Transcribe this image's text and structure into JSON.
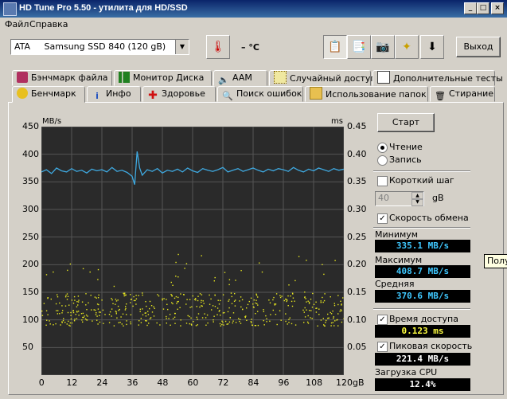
{
  "window": {
    "title": "HD Tune Pro 5.50 - утилита для HD/SSD"
  },
  "menu": [
    "Файл",
    "Справка"
  ],
  "toolbar": {
    "drive": "ATA     Samsung SSD 840 (120 gB)",
    "temperature": "– °C",
    "exit_label": "Выход"
  },
  "tabs_top": [
    "Бэнчмарк файла",
    "Монитор Диска",
    "AAM",
    "Случайный доступ",
    "Дополнительные  тесты"
  ],
  "tabs_bottom": [
    "Бенчмарк",
    "Инфо",
    "Здоровье",
    "Поиск ошибок",
    "Использование папок",
    "Стирание"
  ],
  "side": {
    "start_label": "Старт",
    "read_label": "Чтение",
    "write_label": "Запись",
    "short_step_label": "Короткий шаг",
    "step_value": "40",
    "step_unit": "gB",
    "transfer_label": "Скорость обмена",
    "min_label": "Минимум",
    "min_value": "335.1 MB/s",
    "max_label": "Максимум",
    "max_value": "408.7 MB/s",
    "avg_label": "Средняя",
    "avg_value": "370.6 MB/s",
    "access_label": "Время доступа",
    "access_value": "0.123 ms",
    "burst_label": "Пиковая скорость",
    "burst_value": "221.4 MB/s",
    "cpu_label": "Загрузка CPU",
    "cpu_value": "12.4%"
  },
  "tooltip": "Получ",
  "colors": {
    "transfer": "#3fa9e0",
    "access": "#e8e820",
    "chart_bg": "#2a2a2a",
    "cyan_text": "#3fc8ff",
    "yellow_text": "#ffff40"
  },
  "chart_data": {
    "type": "line",
    "ylabel_left": "MB/s",
    "ylabel_right": "ms",
    "xlabel_unit": "gB",
    "x_ticks": [
      "0",
      "12",
      "24",
      "36",
      "48",
      "60",
      "72",
      "84",
      "96",
      "108",
      "120gB"
    ],
    "y_left_ticks": [
      "450",
      "400",
      "350",
      "300",
      "250",
      "200",
      "150",
      "100",
      "50"
    ],
    "y_right_ticks": [
      "0.45",
      "0.40",
      "0.35",
      "0.30",
      "0.25",
      "0.20",
      "0.15",
      "0.10",
      "0.05"
    ],
    "xlim": [
      0,
      120
    ],
    "ylim_left": [
      0,
      450
    ],
    "ylim_right": [
      0,
      0.45
    ],
    "grid": true,
    "series": [
      {
        "name": "transfer rate",
        "x": [
          0,
          2,
          4,
          6,
          8,
          10,
          12,
          14,
          16,
          18,
          20,
          22,
          24,
          26,
          28,
          30,
          32,
          34,
          36,
          37,
          38,
          39,
          40,
          42,
          44,
          46,
          48,
          50,
          52,
          54,
          56,
          58,
          60,
          62,
          64,
          66,
          68,
          70,
          72,
          74,
          76,
          78,
          80,
          82,
          84,
          86,
          88,
          90,
          92,
          94,
          96,
          98,
          100,
          102,
          104,
          106,
          108,
          110,
          112,
          114,
          116,
          118,
          120
        ],
        "values": [
          368,
          372,
          365,
          375,
          370,
          368,
          374,
          369,
          371,
          366,
          373,
          370,
          372,
          368,
          376,
          369,
          371,
          367,
          360,
          345,
          405,
          375,
          362,
          372,
          369,
          374,
          366,
          371,
          369,
          373,
          368,
          375,
          370,
          367,
          374,
          371,
          369,
          372,
          376,
          368,
          371,
          374,
          369,
          372,
          375,
          371,
          368,
          373,
          370,
          374,
          372,
          369,
          376,
          371,
          368,
          373,
          370,
          375,
          372,
          369,
          374,
          371,
          373
        ]
      },
      {
        "name": "access time",
        "points": "scatter ~0.09–0.15 ms across 0–120 gB, mean 0.123 ms, sparse outliers up to 0.22 ms"
      }
    ]
  }
}
